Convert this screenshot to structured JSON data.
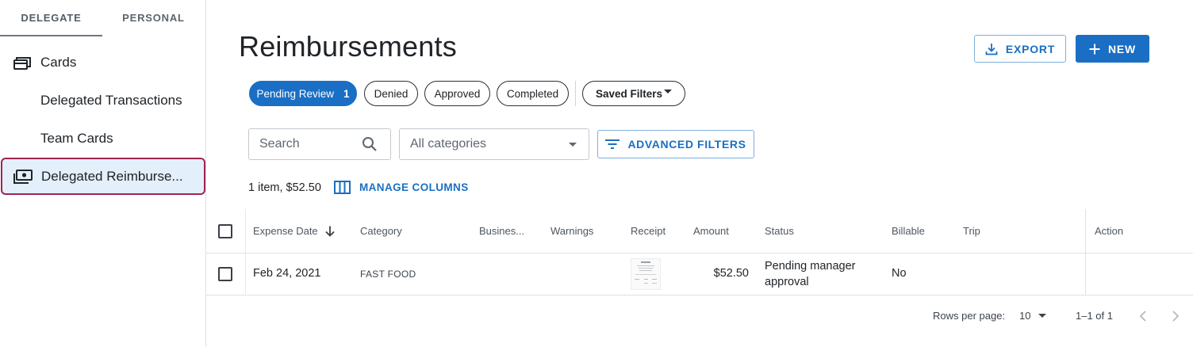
{
  "sidebar": {
    "tabs": [
      {
        "label": "DELEGATE"
      },
      {
        "label": "PERSONAL"
      }
    ],
    "items": [
      {
        "label": "Cards",
        "icon": "cards-icon"
      },
      {
        "label": "Delegated Transactions"
      },
      {
        "label": "Team Cards"
      },
      {
        "label": "Delegated Reimburse...",
        "icon": "cash-icon",
        "active": true
      }
    ]
  },
  "header": {
    "title": "Reimbursements",
    "export_label": "EXPORT",
    "new_label": "NEW"
  },
  "filters": {
    "chips": [
      {
        "label": "Pending Review",
        "count": "1",
        "selected": true
      },
      {
        "label": "Denied"
      },
      {
        "label": "Approved"
      },
      {
        "label": "Completed"
      }
    ],
    "saved_filters_label": "Saved Filters",
    "search_placeholder": "Search",
    "category_value": "All categories",
    "advanced_filters_label": "ADVANCED FILTERS"
  },
  "summary": {
    "text": "1 item, $52.50",
    "manage_columns_label": "MANAGE COLUMNS"
  },
  "table": {
    "columns": [
      "Expense Date",
      "Category",
      "Busines...",
      "Warnings",
      "Receipt",
      "Amount",
      "Status",
      "Billable",
      "Trip",
      "Action"
    ],
    "rows": [
      {
        "expense_date": "Feb 24, 2021",
        "category": "FAST FOOD",
        "business": "",
        "warnings": "",
        "amount": "$52.50",
        "status_line1": "Pending manager",
        "status_line2": "approval",
        "billable": "No",
        "trip": ""
      }
    ]
  },
  "pagination": {
    "rows_per_page_label": "Rows per page:",
    "rows_per_page_value": "10",
    "range": "1–1 of 1"
  },
  "colors": {
    "primary": "#1a6fc4",
    "active_nav_bg": "#e3effa",
    "active_nav_border": "#a0254f"
  }
}
